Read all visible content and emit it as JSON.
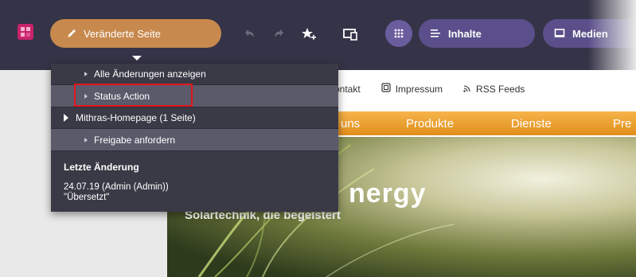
{
  "toolbar": {
    "changed_page_label": "Veränderte Seite",
    "inhalte_label": "Inhalte",
    "medien_label": "Medien"
  },
  "menu": {
    "items": [
      {
        "label": "Alle Änderungen anzeigen"
      },
      {
        "label": "Status Action"
      },
      {
        "label": "Mithras-Homepage (1 Seite)"
      },
      {
        "label": "Freigabe anfordern"
      }
    ],
    "last_change_title": "Letzte Änderung",
    "last_change_info": "24.07.19 (Admin (Admin))",
    "last_change_note": "\"Übersetzt\""
  },
  "page": {
    "links": [
      "ontakt",
      "Impressum",
      "RSS Feeds"
    ],
    "nav": [
      "uns",
      "Produkte",
      "Dienste",
      "Pre"
    ],
    "hero_title": "nergy",
    "hero_subtitle": "Solartechnik, die begeistert"
  },
  "colors": {
    "toolbar_bg": "#353347",
    "accent_pill": "#c8894e",
    "purple_pill": "#5a4f8a",
    "menu_bg": "#3a3a47",
    "highlight_border": "#e4151b",
    "nav_orange": "#f0a93a"
  }
}
